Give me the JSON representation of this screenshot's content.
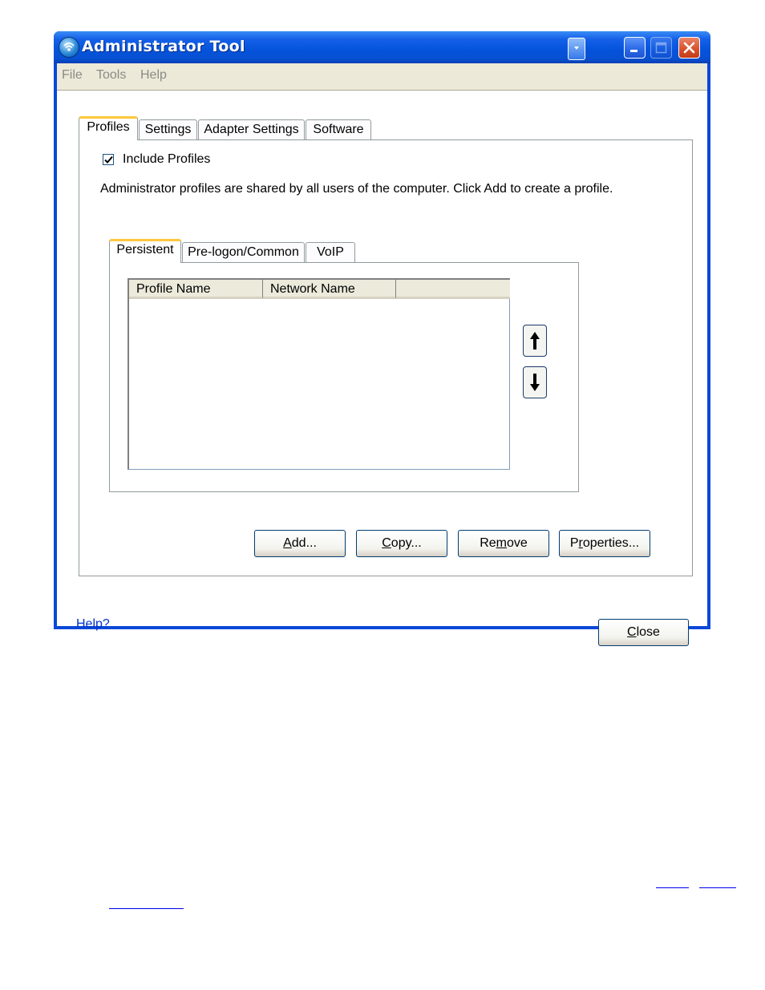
{
  "window": {
    "title": "Administrator Tool"
  },
  "menu": [
    "File",
    "Tools",
    "Help"
  ],
  "tabs": [
    "Profiles",
    "Settings",
    "Adapter Settings",
    "Software"
  ],
  "profiles_tab": {
    "include_profiles_label": "Include Profiles",
    "include_profiles_checked": true,
    "description": "Administrator profiles are shared by all users of the computer. Click Add to create a profile."
  },
  "subtabs": [
    "Persistent",
    "Pre-logon/Common",
    "VoIP"
  ],
  "list": {
    "columns": [
      "Profile Name",
      "Network Name",
      ""
    ],
    "rows": []
  },
  "buttons": {
    "add": {
      "pre": "",
      "key": "A",
      "post": "dd..."
    },
    "copy": {
      "pre": "",
      "key": "C",
      "post": "opy..."
    },
    "remove": {
      "pre": "Re",
      "key": "m",
      "post": "ove"
    },
    "properties": {
      "pre": "P",
      "key": "r",
      "post": "operties..."
    },
    "close": {
      "pre": "",
      "key": "C",
      "post": "lose"
    }
  },
  "help_link": "Help?",
  "colors": {
    "titlebar": "#0553db",
    "window_face": "#ece9d8",
    "active_tab_accent": "#ffc83c",
    "link": "#0033cc"
  },
  "icons": [
    "wireless-app-icon",
    "minimize-icon",
    "maximize-icon",
    "close-icon",
    "arrow-up-icon",
    "arrow-down-icon",
    "checkmark-icon"
  ]
}
